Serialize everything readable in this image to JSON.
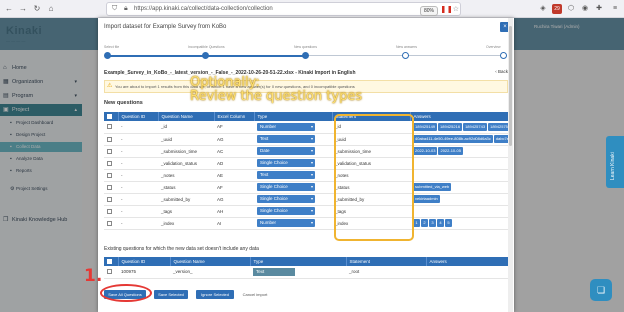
{
  "browser": {
    "url": "https://app.kinaki.ca/collect/data-collection/collection",
    "zoom": "80%",
    "badge_count": "29"
  },
  "app": {
    "logo": "Kinaki",
    "logo_sub": "— — — —",
    "user_name": "Ruchira Tiwari (Admin)"
  },
  "sidebar": {
    "items": [
      {
        "label": "Home"
      },
      {
        "label": "Organization"
      },
      {
        "label": "Program"
      },
      {
        "label": "Project"
      }
    ],
    "subitems": [
      {
        "label": "Project Dashboard"
      },
      {
        "label": "Design Project"
      },
      {
        "label": "Collect Data"
      },
      {
        "label": "Analyze Data"
      },
      {
        "label": "Reports"
      },
      {
        "label": "Project Settings"
      }
    ],
    "knowledge_hub": "Kinaki Knowledge Hub"
  },
  "modal": {
    "title": "Import dataset for Example Survey from KoBo",
    "close": "×",
    "steps": [
      "Select file",
      "Incompatible Questions",
      "New questions",
      "New answers",
      "Overview"
    ],
    "file_line": "Example_Survey_in_KoBo_-_latest_version_-_False_-_2022-10-26-20-51-22.xlsx - Kinaki Import in English",
    "back_label": "‹ Back",
    "warning_text": "You are about to import 1 results from this data set, of which 1 have a new answer(s) for 0 new questions, and 0 incompatible questions",
    "new_questions_title": "New questions",
    "existing_title": "Existing questions for which the new data set doesn't include any data"
  },
  "new_table": {
    "headers": [
      "",
      "Question ID",
      "Question Name",
      "Excel Column",
      "Type",
      "Statement",
      "Answers"
    ],
    "rows": [
      {
        "id": "-",
        "name": "_id",
        "col": "AF",
        "type": "Number",
        "statement": "_id",
        "answers": [
          "189425149",
          "189425216",
          "189425743",
          "18942575"
        ]
      },
      {
        "id": "-",
        "name": "_uuid",
        "col": "AG",
        "type": "Text",
        "statement": "_uuid",
        "answers": [
          "40aba411-4e50-49ee-808b-ac92d08d6a3c",
          "dabc7ee"
        ]
      },
      {
        "id": "-",
        "name": "_submission_time",
        "col": "AC",
        "type": "Date",
        "statement": "_submission_time",
        "answers": [
          "2022-10-03",
          "2022-10-05"
        ]
      },
      {
        "id": "-",
        "name": "_validation_status",
        "col": "AD",
        "type": "Single Choice",
        "statement": "_validation_status",
        "answers": []
      },
      {
        "id": "-",
        "name": "_notes",
        "col": "AE",
        "type": "Text",
        "statement": "_notes",
        "answers": []
      },
      {
        "id": "-",
        "name": "_status",
        "col": "AF",
        "type": "Single Choice",
        "statement": "_status",
        "answers": [
          "submitted_via_web"
        ]
      },
      {
        "id": "-",
        "name": "_submitted_by",
        "col": "AG",
        "type": "Single Choice",
        "statement": "_submitted_by",
        "answers": [
          "vekirtaadmin"
        ]
      },
      {
        "id": "-",
        "name": "_tags",
        "col": "AH",
        "type": "Single Choice",
        "statement": "_tags",
        "answers": []
      },
      {
        "id": "-",
        "name": "_index",
        "col": "AI",
        "type": "Number",
        "statement": "_index",
        "answers": [
          "1",
          "2",
          "3",
          "4",
          "5"
        ]
      }
    ]
  },
  "existing_table": {
    "headers": [
      "",
      "Question ID",
      "Question Name",
      "Type",
      "Statement",
      "Answers"
    ],
    "rows": [
      {
        "id": "100975",
        "name": "_version_",
        "type": "Text",
        "statement": "_root",
        "answers": ""
      }
    ]
  },
  "buttons": {
    "save_all": "Save All Questions",
    "save_selected": "Save Selected",
    "ignore_selected": "Ignore Selected",
    "cancel_import": "Cancel import"
  },
  "right_widgets": {
    "learn": "Learn Kinaki"
  },
  "annotations": {
    "optional_line1": "Optionally:",
    "optional_line2": "Review the question types",
    "step_number": "1."
  },
  "colors": {
    "accent": "#2f6eb5",
    "header": "#5a8aa0",
    "callout": "#f0b430",
    "marker": "#e53935"
  }
}
